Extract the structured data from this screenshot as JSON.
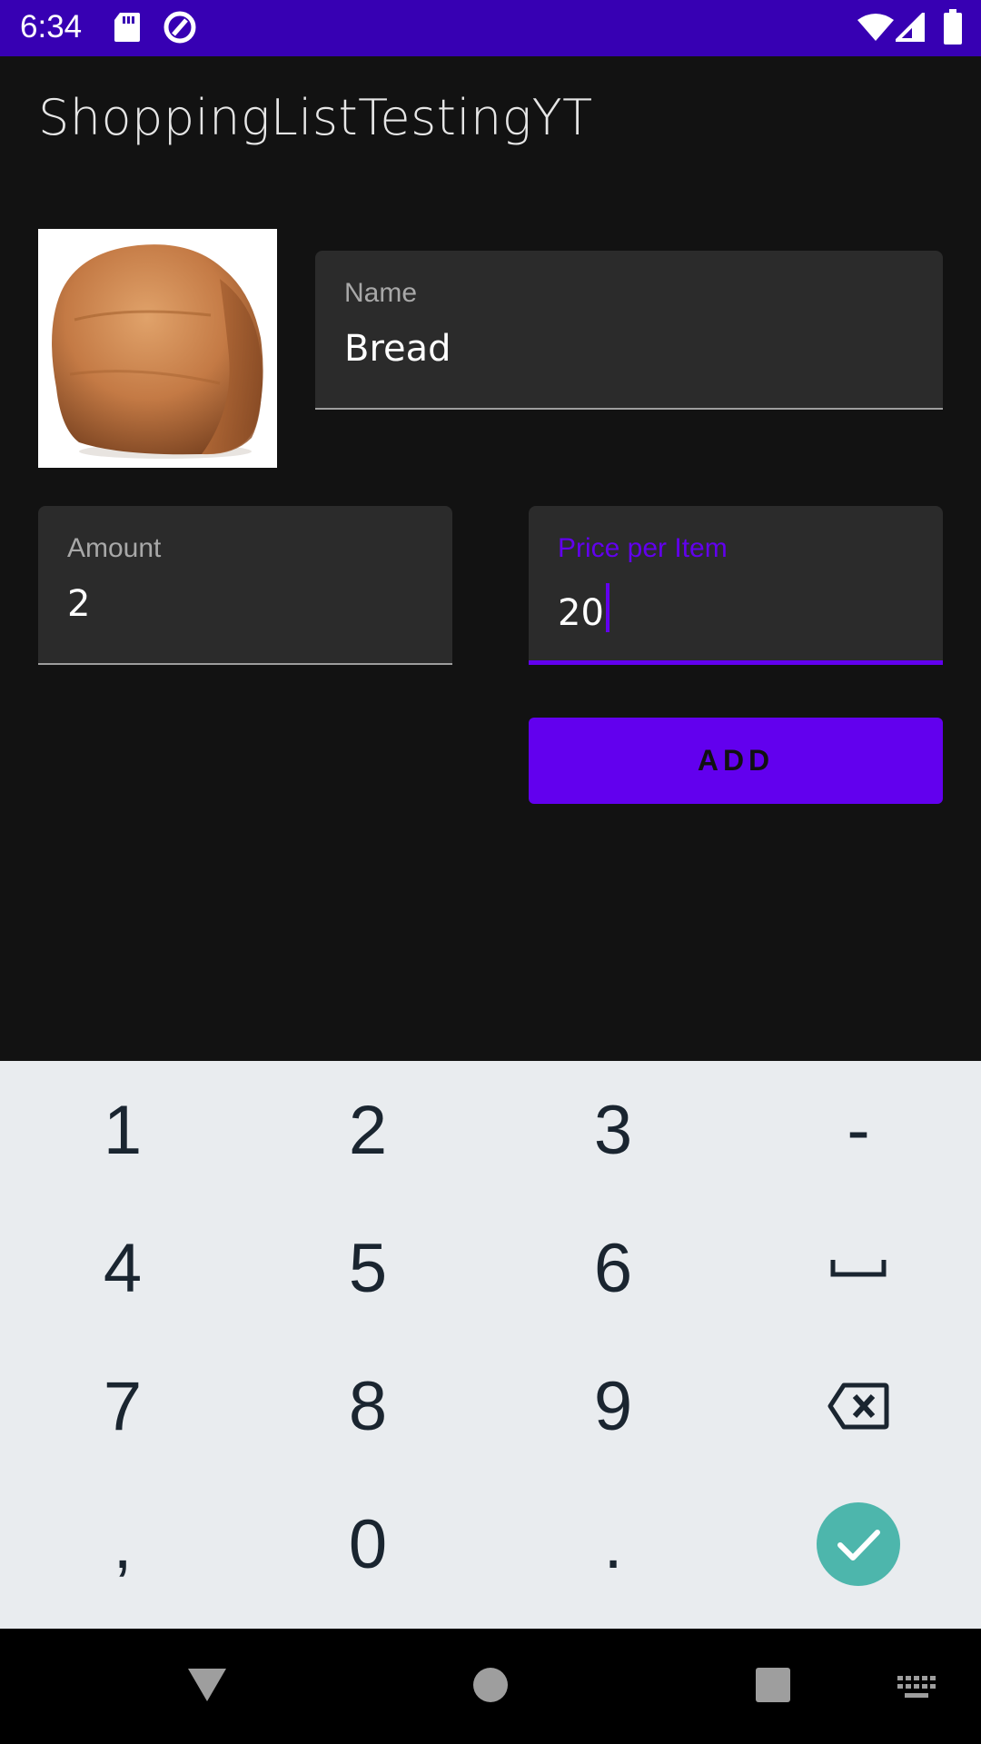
{
  "status_bar": {
    "time": "6:34",
    "bg_color": "#3700B3"
  },
  "app": {
    "title": "ShoppingListTestingYT"
  },
  "image": {
    "icon": "bread-image"
  },
  "fields": {
    "name": {
      "label": "Name",
      "value": "Bread"
    },
    "amount": {
      "label": "Amount",
      "value": "2"
    },
    "price": {
      "label": "Price per Item",
      "value": "20"
    }
  },
  "buttons": {
    "add_label": "ADD"
  },
  "keyboard": {
    "keys": [
      "1",
      "2",
      "3",
      "-",
      "4",
      "5",
      "6",
      "space",
      "7",
      "8",
      "9",
      "backspace",
      ",",
      "0",
      ".",
      "done"
    ],
    "k1": "1",
    "k2": "2",
    "k3": "3",
    "kminus": "-",
    "k4": "4",
    "k5": "5",
    "k6": "6",
    "k7": "7",
    "k8": "8",
    "k9": "9",
    "kcomma": ",",
    "k0": "0",
    "kdot": "."
  },
  "colors": {
    "accent": "#6200EE",
    "done_key": "#4DB6AC",
    "background": "#121212"
  }
}
